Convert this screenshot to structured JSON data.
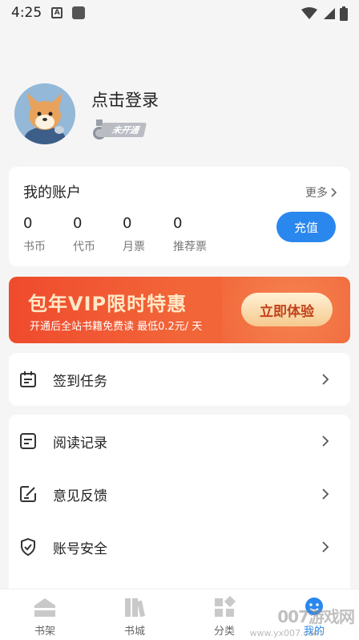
{
  "status_bar": {
    "time": "4:25",
    "notif_letter": "A"
  },
  "profile": {
    "login_text": "点击登录",
    "vip_status": "未开通"
  },
  "account": {
    "title": "我的账户",
    "more": "更多",
    "stats": [
      {
        "value": "0",
        "label": "书币"
      },
      {
        "value": "0",
        "label": "代币"
      },
      {
        "value": "0",
        "label": "月票"
      },
      {
        "value": "0",
        "label": "推荐票"
      }
    ],
    "recharge": "充值"
  },
  "vip_banner": {
    "headline": "包年VIP限时特惠",
    "subtitle": "开通后全站书籍免费读 最低0.2元/ 天",
    "button": "立即体验"
  },
  "menu": {
    "checkin": "签到任务",
    "history": "阅读记录",
    "feedback": "意见反馈",
    "security": "账号安全"
  },
  "nav": [
    {
      "label": "书架"
    },
    {
      "label": "书城"
    },
    {
      "label": "分类"
    },
    {
      "label": "我的"
    }
  ],
  "watermark": {
    "main": "007游戏网",
    "url": "www.yx007.com"
  },
  "colors": {
    "primary": "#2a87ee",
    "banner": "#ef4b2d",
    "background": "#f5f5f5"
  }
}
